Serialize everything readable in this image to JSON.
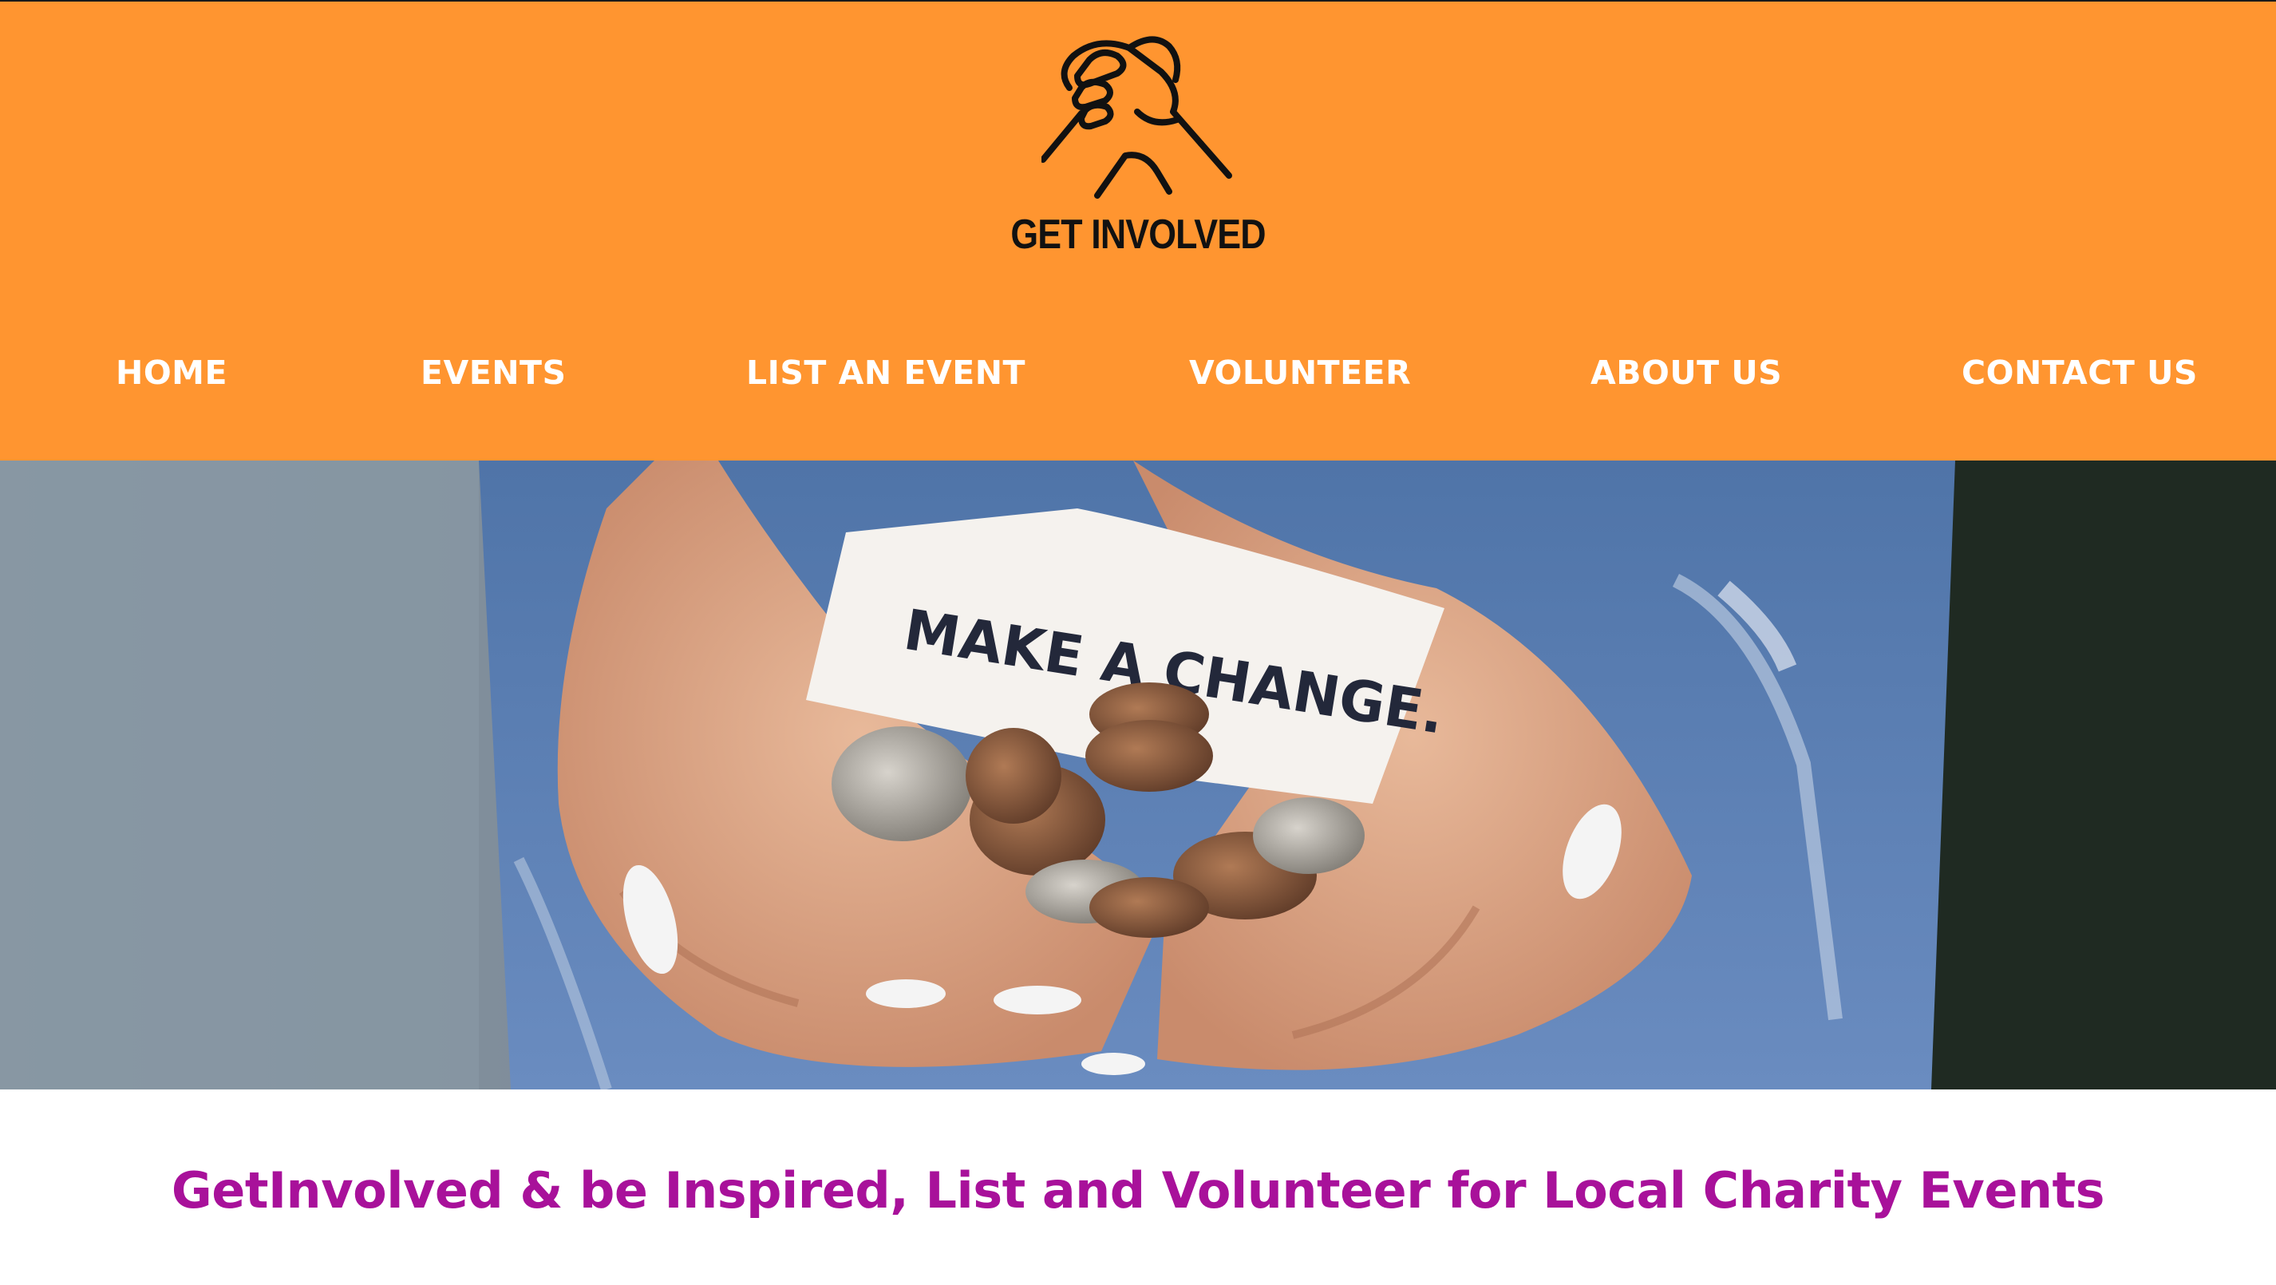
{
  "brand": {
    "logo_text": "GET INVOLVED",
    "logo_icon": "clasped-hands-icon",
    "header_color": "#ff9530"
  },
  "nav": {
    "items": [
      {
        "label": "HOME"
      },
      {
        "label": "EVENTS"
      },
      {
        "label": "LIST AN EVENT"
      },
      {
        "label": "VOLUNTEER"
      },
      {
        "label": "ABOUT US"
      },
      {
        "label": "CONTACT US"
      }
    ]
  },
  "hero": {
    "note_text": "MAKE A CHANGE."
  },
  "main": {
    "tagline": "GetInvolved & be Inspired, List and Volunteer for Local Charity Events",
    "tagline_color": "#a8119a"
  }
}
